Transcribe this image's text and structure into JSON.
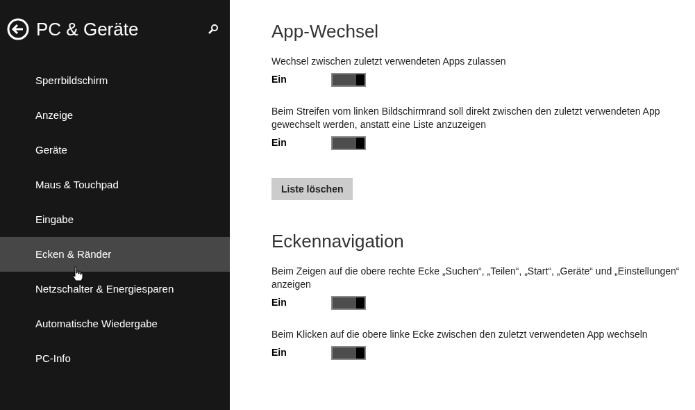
{
  "sidebar": {
    "title": "PC & Geräte",
    "items": [
      {
        "label": "Sperrbildschirm",
        "selected": false
      },
      {
        "label": "Anzeige",
        "selected": false
      },
      {
        "label": "Geräte",
        "selected": false
      },
      {
        "label": "Maus & Touchpad",
        "selected": false
      },
      {
        "label": "Eingabe",
        "selected": false
      },
      {
        "label": "Ecken & Ränder",
        "selected": true
      },
      {
        "label": "Netzschalter & Energiesparen",
        "selected": false
      },
      {
        "label": "Automatische Wiedergabe",
        "selected": false
      },
      {
        "label": "PC-Info",
        "selected": false
      }
    ]
  },
  "sections": [
    {
      "heading": "App-Wechsel",
      "settings": [
        {
          "kind": "toggle",
          "description": "Wechsel zwischen zuletzt verwendeten Apps zulassen",
          "state_label": "Ein",
          "on": true
        },
        {
          "kind": "toggle",
          "description": "Beim Streifen vom linken Bildschirmrand soll direkt zwischen den zuletzt verwendeten App gewechselt werden, anstatt eine Liste anzuzeigen",
          "state_label": "Ein",
          "on": true
        },
        {
          "kind": "button",
          "label": "Liste löschen"
        }
      ]
    },
    {
      "heading": "Eckennavigation",
      "settings": [
        {
          "kind": "toggle",
          "description": "Beim Zeigen auf die obere rechte Ecke „Suchen“, „Teilen“, „Start“, „Geräte“ und „Einstellungen“ anzeigen",
          "state_label": "Ein",
          "on": true
        },
        {
          "kind": "toggle",
          "description": "Beim Klicken auf die obere linke Ecke zwischen den zuletzt verwendeten App wechseln",
          "state_label": "Ein",
          "on": true
        }
      ]
    }
  ]
}
